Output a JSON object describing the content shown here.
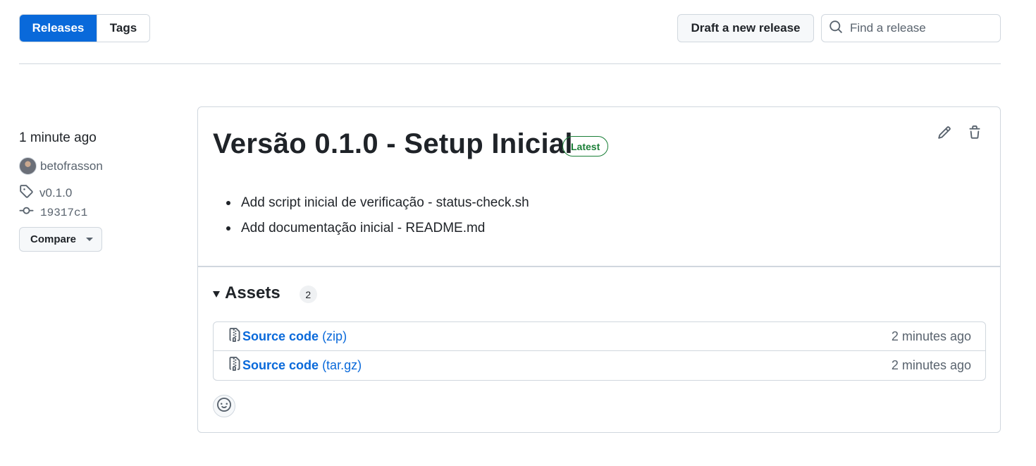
{
  "toolbar": {
    "tabs": [
      {
        "label": "Releases",
        "active": true
      },
      {
        "label": "Tags",
        "active": false
      }
    ],
    "draft_button_label": "Draft a new release",
    "search_placeholder": "Find a release"
  },
  "sidebar": {
    "time": "1 minute ago",
    "author": "betofrasson",
    "tag": "v0.1.0",
    "commit": "19317c1",
    "compare_label": "Compare"
  },
  "release": {
    "title": "Versão 0.1.0 - Setup Inicial",
    "badge": "Latest",
    "notes": [
      "Add script inicial de verificação - status-check.sh",
      "Add documentação inicial - README.md"
    ],
    "assets_title": "Assets",
    "assets_count": "2",
    "assets": [
      {
        "name": "Source code",
        "ext": "(zip)",
        "time": "2 minutes ago"
      },
      {
        "name": "Source code",
        "ext": "(tar.gz)",
        "time": "2 minutes ago"
      }
    ]
  },
  "colors": {
    "accent": "#0969da",
    "success": "#1a7f37",
    "border": "#d0d7de",
    "muted_text": "#59636e"
  },
  "icons": [
    "search-icon",
    "tag-icon",
    "commit-icon",
    "pencil-icon",
    "trash-icon",
    "file-zip-icon",
    "smiley-icon",
    "triangle-down-icon"
  ]
}
